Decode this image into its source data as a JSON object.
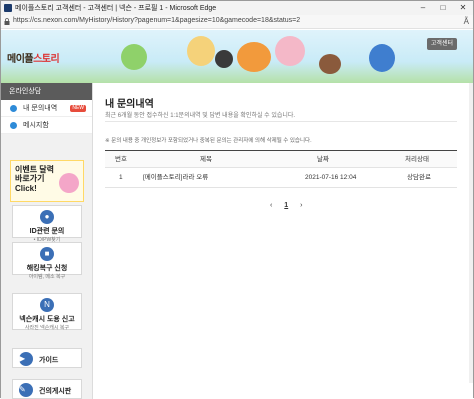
{
  "window": {
    "title": "메이플스토리 고객센터 - 고객센터 | 넥슨 - 프로필 1 - Microsoft Edge",
    "url": "https://cs.nexon.com/MyHistory/History?pagenum=1&pagesize=10&gamecode=18&status=2",
    "minimize_icon": "minimize-icon",
    "maximize_icon": "maximize-icon",
    "close_icon": "close-icon"
  },
  "header": {
    "logo_text": "메이플",
    "logo_text2": "스토리",
    "cs_button": "고객센터"
  },
  "sidebar": {
    "head": "온라인상담",
    "items": [
      {
        "label": "내 문의내역",
        "badge": "NEW"
      },
      {
        "label": "메시지함"
      }
    ],
    "event": {
      "line1": "이벤트 달력",
      "line2": "바로가기",
      "line3": "Click!"
    },
    "cards": [
      {
        "icon": "id-icon",
        "title": "ID관련 문의",
        "sub": "• ID/PW찾기\n• 비활성 계정"
      },
      {
        "icon": "lock-icon",
        "title": "해킹복구 신청",
        "sub": "아이템, 메소 복구"
      },
      {
        "icon": "nexon-icon",
        "title": "넥슨캐시 도용 신고",
        "sub": "사라진 넥슨캐시 복구"
      },
      {
        "icon": "guide-icon",
        "title": "가이드",
        "sub": ""
      },
      {
        "icon": "board-icon",
        "title": "건의게시판",
        "sub": ""
      }
    ]
  },
  "main": {
    "title": "내 문의내역",
    "desc": "최근 6개월 동안 접수하신 1:1문의내역 및 답변 내용을 확인하실 수 있습니다.",
    "notice": "※ 문의 내용 중 개인정보가 포함되었거나 중복된 문의는 관리자에 의해 삭제될 수 있습니다.",
    "columns": {
      "no": "번호",
      "title": "제목",
      "date": "날짜",
      "status": "처리상태"
    },
    "rows": [
      {
        "no": "1",
        "title": "[메이플스토리]라라 오류",
        "date": "2021-07-16 12:04",
        "status": "상담완료"
      }
    ],
    "pager": {
      "prev": "‹",
      "current": "1",
      "next": "›"
    }
  }
}
